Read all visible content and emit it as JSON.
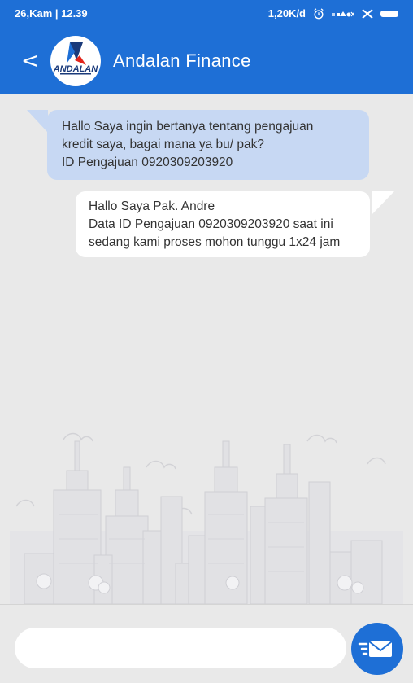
{
  "status_bar": {
    "left": "26,Kam | 12.39",
    "speed": "1,20K/d"
  },
  "header": {
    "back_icon": "chevron-left-icon",
    "back_glyph": "<",
    "logo_text": "ANDALAN",
    "title": "Andalan Finance"
  },
  "messages": [
    {
      "direction": "incoming",
      "text": "Hallo Saya ingin bertanya tentang pengajuan\nkredit saya, bagai mana ya bu/ pak?\nID Pengajuan 0920309203920"
    },
    {
      "direction": "outgoing",
      "text": "Hallo Saya Pak. Andre\nData ID Pengajuan 0920309203920 saat ini\nsedang kami proses mohon tunggu 1x24 jam"
    }
  ],
  "composer": {
    "value": "",
    "placeholder": "",
    "send_icon": "send-mail-icon"
  },
  "colors": {
    "primary": "#1e6fd6",
    "incoming_bubble": "#c7d8f3",
    "outgoing_bubble": "#ffffff",
    "background": "#e9e9e9"
  }
}
